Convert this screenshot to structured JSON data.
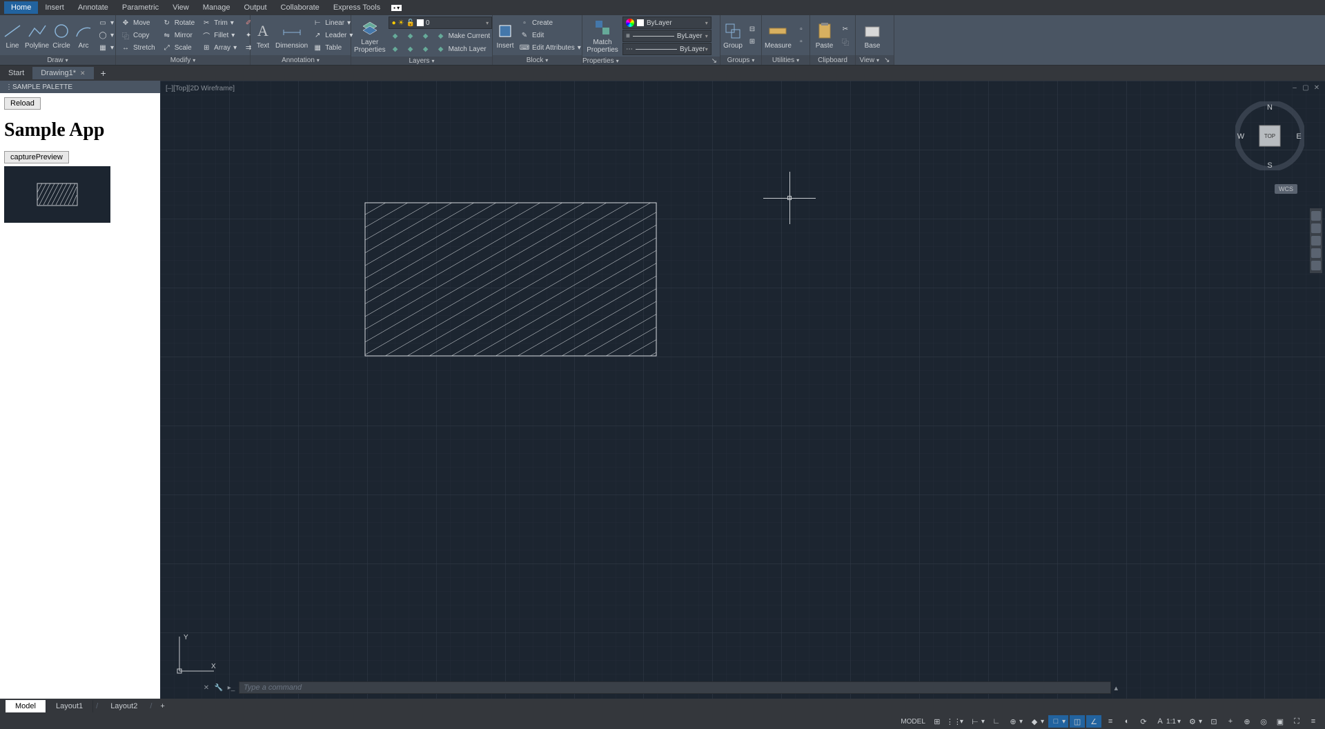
{
  "menu": {
    "tabs": [
      "Home",
      "Insert",
      "Annotate",
      "Parametric",
      "View",
      "Manage",
      "Output",
      "Collaborate",
      "Express Tools"
    ],
    "active": 0
  },
  "ribbon": {
    "draw": {
      "title": "Draw",
      "line": "Line",
      "polyline": "Polyline",
      "circle": "Circle",
      "arc": "Arc"
    },
    "modify": {
      "title": "Modify",
      "move": "Move",
      "copy": "Copy",
      "stretch": "Stretch",
      "rotate": "Rotate",
      "mirror": "Mirror",
      "scale": "Scale",
      "trim": "Trim",
      "fillet": "Fillet",
      "array": "Array"
    },
    "annotation": {
      "title": "Annotation",
      "text": "Text",
      "dimension": "Dimension",
      "linear": "Linear",
      "leader": "Leader",
      "table": "Table"
    },
    "layers": {
      "title": "Layers",
      "layerprops": "Layer\nProperties",
      "current_layer": "0",
      "makecurrent": "Make Current",
      "matchlayer": "Match Layer"
    },
    "block": {
      "title": "Block",
      "insert": "Insert",
      "create": "Create",
      "edit": "Edit",
      "editattr": "Edit Attributes"
    },
    "properties": {
      "title": "Properties",
      "matchprops": "Match\nProperties",
      "layer_color": "ByLayer",
      "linetype": "ByLayer",
      "lineweight": "ByLayer"
    },
    "groups": {
      "title": "Groups",
      "group": "Group"
    },
    "utilities": {
      "title": "Utilities",
      "measure": "Measure"
    },
    "clipboard": {
      "title": "Clipboard",
      "paste": "Paste"
    },
    "view": {
      "title": "View",
      "base": "Base"
    }
  },
  "filetabs": {
    "start": "Start",
    "drawing": "Drawing1*"
  },
  "palette": {
    "title": "SAMPLE PALETTE",
    "reload": "Reload",
    "heading": "Sample App",
    "capture": "capturePreview"
  },
  "viewport": {
    "label": "[–][Top][2D Wireframe]"
  },
  "viewcube": {
    "top": "TOP",
    "n": "N",
    "s": "S",
    "e": "E",
    "w": "W",
    "wcs": "WCS"
  },
  "ucs": {
    "x": "X",
    "y": "Y"
  },
  "cmdline": {
    "placeholder": "Type a command"
  },
  "layouttabs": {
    "model": "Model",
    "layout1": "Layout1",
    "layout2": "Layout2"
  },
  "statusbar": {
    "model": "MODEL",
    "scale": "1:1"
  }
}
